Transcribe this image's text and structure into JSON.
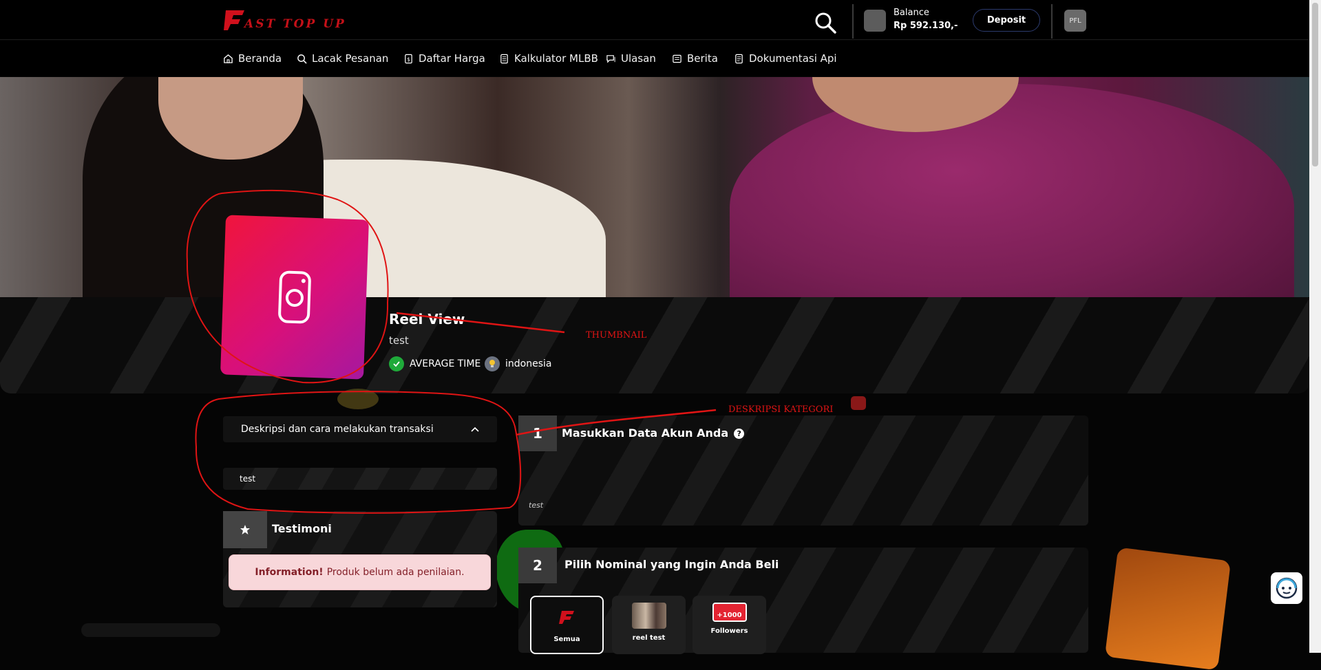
{
  "brand": {
    "logo_text": "FAST TOP UP"
  },
  "header": {
    "balance_label": "Balance",
    "balance_value": "Rp 592.130,-",
    "deposit_label": "Deposit",
    "profile_initials": "PFL"
  },
  "nav": {
    "items": [
      {
        "label": "Beranda",
        "icon": "home-icon"
      },
      {
        "label": "Lacak Pesanan",
        "icon": "search-icon"
      },
      {
        "label": "Daftar Harga",
        "icon": "price-list-icon"
      },
      {
        "label": "Kalkulator MLBB",
        "icon": "calculator-icon"
      },
      {
        "label": "Ulasan",
        "icon": "review-icon"
      },
      {
        "label": "Berita",
        "icon": "news-icon"
      },
      {
        "label": "Dokumentasi Api",
        "icon": "document-icon"
      }
    ]
  },
  "category": {
    "title": "Reel View",
    "subtitle": "test",
    "badges": [
      {
        "label": "AVERAGE TIME",
        "icon": "check-icon",
        "color": "#1faa3a"
      },
      {
        "label": "indonesia",
        "icon": "lightbulb-icon",
        "color": "#6b7280"
      }
    ]
  },
  "sidebar": {
    "description_title": "Deskripsi dan cara melakukan transaksi",
    "description_content": "test",
    "testimoni_title": "Testimoni",
    "alert_strong": "Information!",
    "alert_text": "Produk belum ada penilaian."
  },
  "steps": {
    "step1": {
      "number": "1",
      "title": "Masukkan Data Akun Anda",
      "help": "?",
      "description": "test"
    },
    "step2": {
      "number": "2",
      "title": "Pilih Nominal yang Ingin Anda Beli",
      "options": [
        {
          "label": "Semua",
          "selected": true
        },
        {
          "label": "reel test",
          "selected": false
        },
        {
          "label": "Followers",
          "selected": false,
          "image_text": "+1000"
        }
      ]
    }
  },
  "annotations": {
    "thumbnail": "THUMBNAIL",
    "deskripsi": "DESKRIPSI KATEGORI",
    "color": "#e01414"
  }
}
